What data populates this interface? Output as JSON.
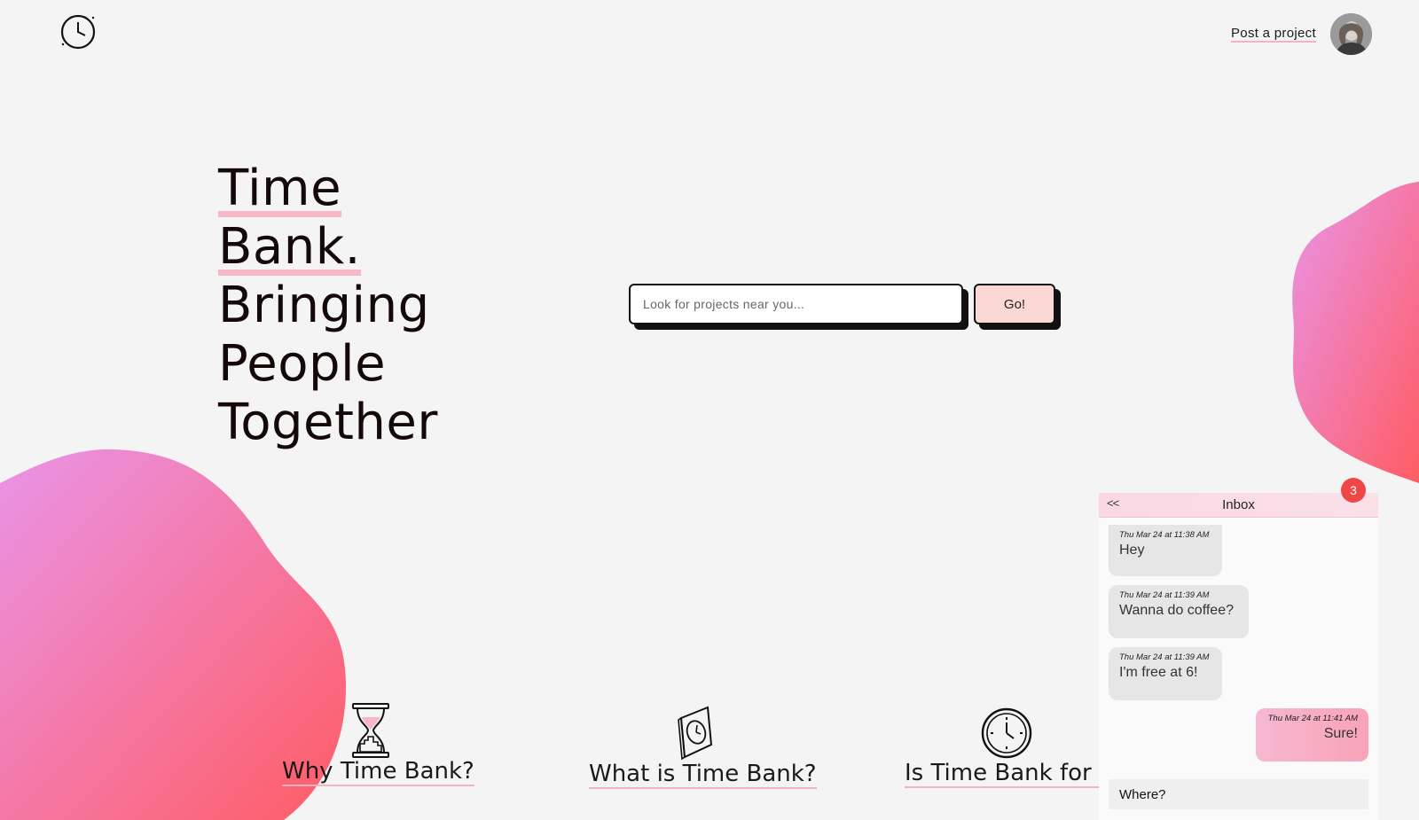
{
  "nav": {
    "post_project_label": "Post a project"
  },
  "hero": {
    "line1": "Time",
    "line2": "Bank.",
    "line3": "Bringing",
    "line4": "People",
    "line5": "Together"
  },
  "search": {
    "placeholder": "Look for projects near you...",
    "button_label": "Go!"
  },
  "features": [
    {
      "label": "Why Time Bank?",
      "icon": "hourglass-icon"
    },
    {
      "label": "What is Time Bank?",
      "icon": "wall-clock-icon"
    },
    {
      "label": "Is Time Bank for you",
      "icon": "clock-icon"
    }
  ],
  "inbox": {
    "back_label": "<<",
    "title": "Inbox",
    "unread_count": "3",
    "messages": [
      {
        "time": "Thu Mar 24 at 11:38 AM",
        "text": "Hey",
        "direction": "in"
      },
      {
        "time": "Thu Mar 24 at 11:39 AM",
        "text": "Wanna do coffee?",
        "direction": "in"
      },
      {
        "time": "Thu Mar 24 at 11:39 AM",
        "text": "I'm free at 6!",
        "direction": "in"
      },
      {
        "time": "Thu Mar 24 at 11:41 AM",
        "text": "Sure!",
        "direction": "out"
      }
    ],
    "reply_value": "Where?"
  },
  "colors": {
    "accent_pink": "#f7b7c6",
    "blob_start": "#e994e8",
    "blob_end": "#ff5c63",
    "badge": "#ef4747"
  }
}
